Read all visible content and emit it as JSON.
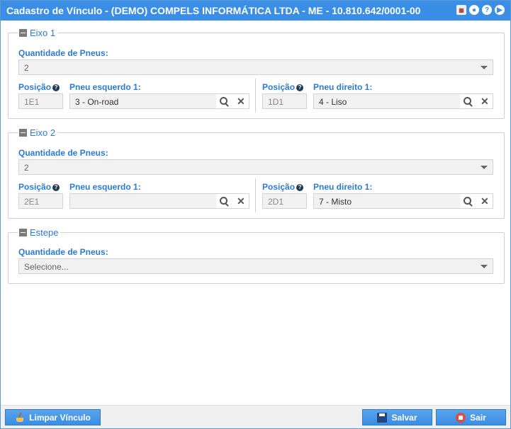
{
  "window": {
    "title": "Cadastro de Vínculo - (DEMO) COMPELS INFORMÁTICA LTDA - ME - 10.810.642/0001-00",
    "icons": [
      "calendar-icon",
      "minimize-icon",
      "help-icon",
      "next-icon"
    ],
    "icon_glyphs": {
      "calendar": "▦",
      "minimize": "●",
      "help": "?",
      "next": "▶"
    }
  },
  "eixo1": {
    "legend": "Eixo 1",
    "quantidade_label": "Quantidade de Pneus:",
    "quantidade_value": "2",
    "posicao_label": "Posição",
    "left_label": "Pneu esquerdo 1:",
    "left_posicao": "1E1",
    "left_pneu": "3 - On-road",
    "right_label": "Pneu direito 1:",
    "right_posicao": "1D1",
    "right_pneu": "4 - Liso"
  },
  "eixo2": {
    "legend": "Eixo 2",
    "quantidade_label": "Quantidade de Pneus:",
    "quantidade_value": "2",
    "posicao_label": "Posição",
    "left_label": "Pneu esquerdo 1:",
    "left_posicao": "2E1",
    "left_pneu": "",
    "right_label": "Pneu direito 1:",
    "right_posicao": "2D1",
    "right_pneu": "7 - Misto"
  },
  "estepe": {
    "legend": "Estepe",
    "quantidade_label": "Quantidade de Pneus:",
    "quantidade_value": "Selecione..."
  },
  "footer": {
    "limpar_label": "Limpar Vínculo",
    "salvar_label": "Salvar",
    "sair_label": "Sair"
  },
  "help_glyph": "?",
  "clear_glyph": "✕",
  "colors": {
    "titlebar": "#3a8ee6",
    "label": "#2a7ad6",
    "button": "#3a8ee6"
  }
}
